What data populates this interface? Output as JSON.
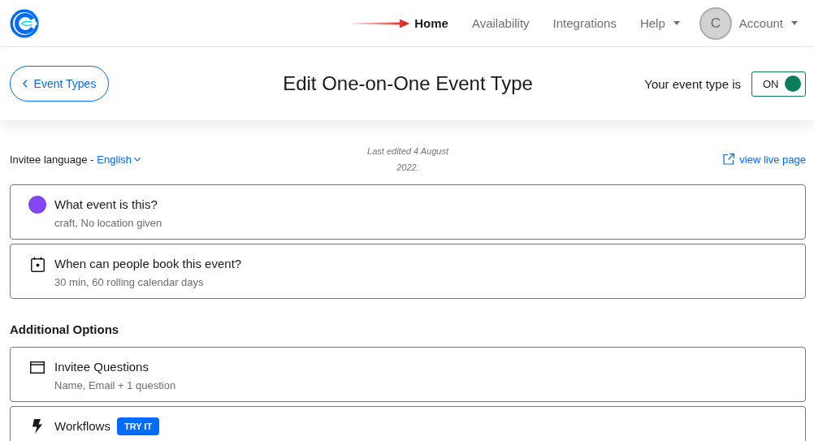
{
  "header": {
    "nav": [
      {
        "label": "Home",
        "selected": true,
        "dropdown": false
      },
      {
        "label": "Availability",
        "selected": false,
        "dropdown": false
      },
      {
        "label": "Integrations",
        "selected": false,
        "dropdown": false
      },
      {
        "label": "Help",
        "selected": false,
        "dropdown": true
      }
    ],
    "account": {
      "avatar": "C",
      "label": "Account",
      "dropdown": true
    }
  },
  "toolbar": {
    "back_button": "Event Types",
    "title": "Edit One-on-One Event Type",
    "status_label": "Your event type is",
    "toggle": {
      "label": "ON",
      "on": true
    }
  },
  "meta": {
    "language_label": "Invitee language -",
    "language": "English",
    "last_edited": "Last edited 4 August 2022.",
    "live_link": "view live page"
  },
  "sections": [
    {
      "kind": "color",
      "title": "What event is this?",
      "subtitle": "craft, No location given",
      "color": "#8247f5"
    },
    {
      "kind": "calendar",
      "title": "When can people book this event?",
      "subtitle": "30 min, 60 rolling calendar days"
    }
  ],
  "additional": {
    "heading": "Additional Options",
    "items": [
      {
        "kind": "form",
        "title": "Invitee Questions",
        "subtitle": "Name, Email + 1 question"
      },
      {
        "kind": "bolt",
        "title": "Workflows",
        "badge": "TRY IT"
      }
    ]
  }
}
